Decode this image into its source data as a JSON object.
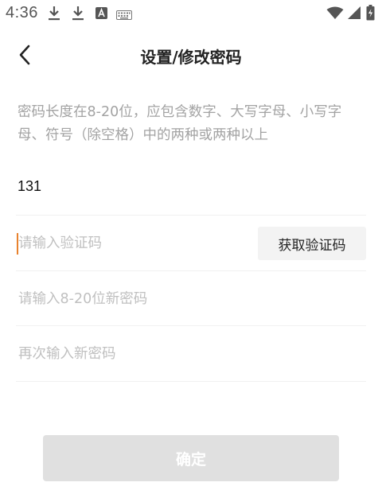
{
  "status_bar": {
    "time": "4:36",
    "icons": [
      "download-icon",
      "download-icon",
      "text-a-icon",
      "keyboard-icon",
      "wifi-icon",
      "signal-icon",
      "battery-icon"
    ],
    "icon_color": "#555555"
  },
  "header": {
    "back_icon": "chevron-left-icon",
    "title": "设置/修改密码"
  },
  "hint": "密码长度在8-20位，应包含数字、大写字母、小写字母、符号（除空格）中的两种或两种以上",
  "form": {
    "phone_value": "131",
    "code_placeholder": "请输入验证码",
    "get_code_label": "获取验证码",
    "new_password_placeholder": "请输入8-20位新密码",
    "confirm_password_placeholder": "再次输入新密码"
  },
  "confirm_label": "确定",
  "colors": {
    "caret": "#e8822e",
    "button_disabled": "#e0e0e0",
    "hint_text": "#a3a3a3"
  }
}
